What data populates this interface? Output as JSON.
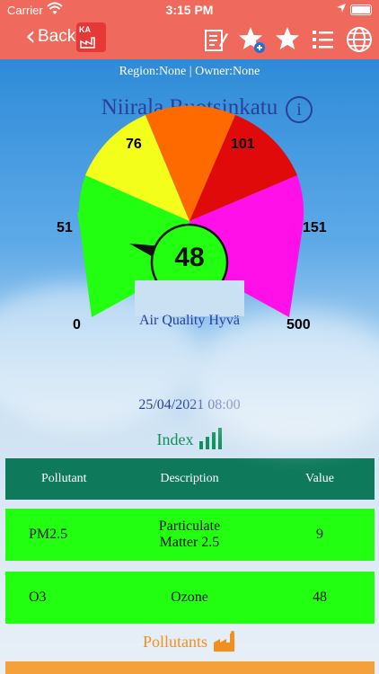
{
  "status_bar": {
    "carrier": "Carrier",
    "time": "3:15 PM"
  },
  "nav": {
    "back_label": "Back",
    "logo_text": "KA"
  },
  "header": {
    "region_text": "Region:None | Owner:None",
    "station_name": "Niirala Ruotsinkatu",
    "info_glyph": "i"
  },
  "gauge": {
    "value": "48",
    "label": "Air Quality Hyvä",
    "ticks": [
      "0",
      "51",
      "76",
      "101",
      "151",
      "500"
    ],
    "colors": [
      "#22ff11",
      "#f3ff1a",
      "#ff6a00",
      "#e00a0a",
      "#ff10e8"
    ]
  },
  "datetime": "25/04/2021 08:00",
  "index_label": "Index",
  "table": {
    "headers": [
      "Pollutant",
      "Description",
      "Value"
    ],
    "rows": [
      {
        "pollutant": "PM2.5",
        "description_line1": "Particulate",
        "description_line2": "Matter 2.5",
        "value": "9"
      },
      {
        "pollutant": "O3",
        "description_line1": "Ozone",
        "description_line2": "",
        "value": "48"
      }
    ]
  },
  "pollutants_label": "Pollutants",
  "colors": {
    "header_bg": "#ef6a5c",
    "table_header": "#0f7a5b",
    "row_bg": "#22ff11",
    "accent_orange": "#f28f1d"
  }
}
